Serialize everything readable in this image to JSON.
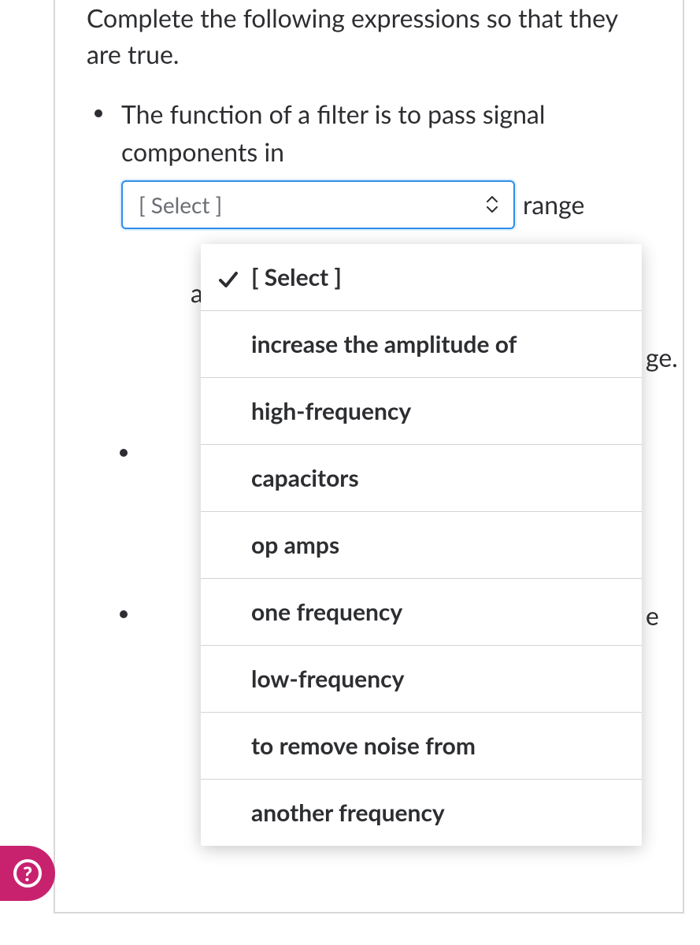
{
  "prompt": "Complete the following expressions so that they are true.",
  "bullets": {
    "b1_text": "The function of a filter is to pass signal components in",
    "b1_after": " range",
    "b1_hidden_a_frag": "a",
    "b1_hidden_ge_frag": "ge.",
    "b2_hidden_frag": "e",
    "b3_hidden_frag": " "
  },
  "select": {
    "placeholder": "[ Select ]"
  },
  "dropdown": {
    "options": [
      "[ Select ]",
      "increase the amplitude of",
      "high-frequency",
      "capacitors",
      "op amps",
      "one frequency",
      "low-frequency",
      "to remove noise from",
      "another frequency"
    ],
    "selected_index": 0
  },
  "help_label": "?"
}
